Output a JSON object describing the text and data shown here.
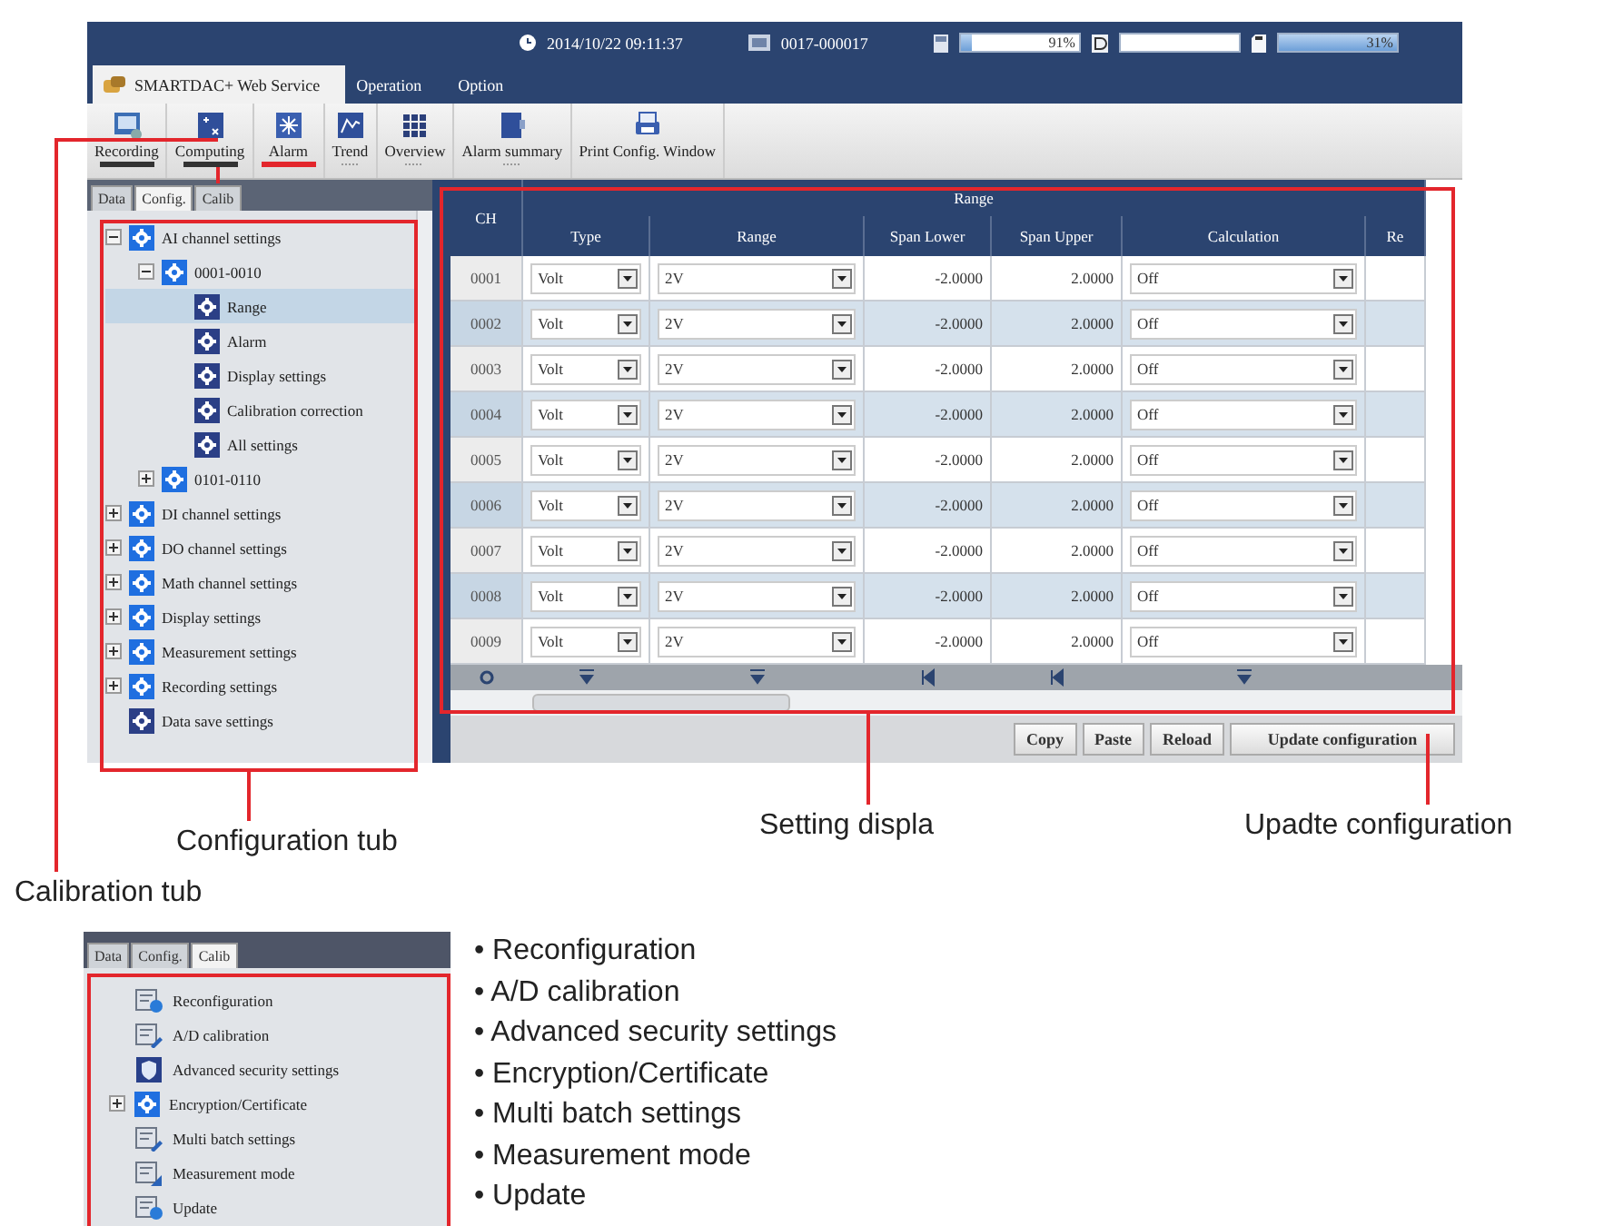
{
  "header": {
    "datetime": "2014/10/22 09:11:37",
    "device_id": "0017-000017",
    "meters": [
      {
        "kind": "memory",
        "reading": "91%",
        "level": 0.1
      },
      {
        "kind": "drive"
      },
      {
        "kind": "card",
        "reading": "31%",
        "level": 1
      }
    ]
  },
  "app_tabs": [
    {
      "label": "SMARTDAC+ Web Service",
      "selected": true
    },
    {
      "label": "Operation",
      "selected": false
    },
    {
      "label": "Option",
      "selected": false
    }
  ],
  "toolbar": [
    {
      "label": "Recording",
      "kind": "bar"
    },
    {
      "label": "Computing",
      "kind": "bar"
    },
    {
      "label": "Alarm",
      "kind": "alert"
    },
    {
      "label": "Trend",
      "kind": "dots"
    },
    {
      "label": "Overview",
      "kind": "dots"
    },
    {
      "label": "Alarm summary",
      "kind": "dots"
    },
    {
      "label": "Print Config. Window",
      "kind": "plain"
    }
  ],
  "side_tabs": [
    {
      "label": "Data",
      "selected": false
    },
    {
      "label": "Config.",
      "selected": true
    },
    {
      "label": "Calib",
      "selected": false
    }
  ],
  "tree": [
    {
      "label": "AI channel settings",
      "expanded": true,
      "selected": false,
      "children": [
        {
          "label": "0001-0010",
          "expanded": true,
          "selected": false,
          "children": [
            {
              "label": "Range",
              "selected": true
            },
            {
              "label": "Alarm",
              "selected": false
            },
            {
              "label": "Display settings",
              "selected": false
            },
            {
              "label": "Calibration correction",
              "selected": false
            },
            {
              "label": "All settings",
              "selected": false
            }
          ]
        },
        {
          "label": "0101-0110",
          "expanded": false,
          "selected": false
        }
      ]
    },
    {
      "label": "DI channel settings",
      "expanded": false,
      "selected": false
    },
    {
      "label": "DO channel settings",
      "expanded": false,
      "selected": false
    },
    {
      "label": "Math channel settings",
      "expanded": false,
      "selected": false
    },
    {
      "label": "Display settings",
      "expanded": false,
      "selected": false
    },
    {
      "label": "Measurement settings",
      "expanded": false,
      "selected": false
    },
    {
      "label": "Recording settings",
      "expanded": false,
      "selected": false
    },
    {
      "label": "Data save settings",
      "selected": false
    }
  ],
  "table": {
    "group_header": "Range",
    "columns": [
      "CH",
      "Type",
      "Range",
      "Span Lower",
      "Span Upper",
      "Calculation",
      "Re"
    ],
    "rows": [
      {
        "ch": "0001",
        "type": "Volt",
        "range": "2V",
        "span_lower": "-2.0000",
        "span_upper": "2.0000",
        "calculation": "Off"
      },
      {
        "ch": "0002",
        "type": "Volt",
        "range": "2V",
        "span_lower": "-2.0000",
        "span_upper": "2.0000",
        "calculation": "Off"
      },
      {
        "ch": "0003",
        "type": "Volt",
        "range": "2V",
        "span_lower": "-2.0000",
        "span_upper": "2.0000",
        "calculation": "Off"
      },
      {
        "ch": "0004",
        "type": "Volt",
        "range": "2V",
        "span_lower": "-2.0000",
        "span_upper": "2.0000",
        "calculation": "Off"
      },
      {
        "ch": "0005",
        "type": "Volt",
        "range": "2V",
        "span_lower": "-2.0000",
        "span_upper": "2.0000",
        "calculation": "Off"
      },
      {
        "ch": "0006",
        "type": "Volt",
        "range": "2V",
        "span_lower": "-2.0000",
        "span_upper": "2.0000",
        "calculation": "Off"
      },
      {
        "ch": "0007",
        "type": "Volt",
        "range": "2V",
        "span_lower": "-2.0000",
        "span_upper": "2.0000",
        "calculation": "Off"
      },
      {
        "ch": "0008",
        "type": "Volt",
        "range": "2V",
        "span_lower": "-2.0000",
        "span_upper": "2.0000",
        "calculation": "Off"
      },
      {
        "ch": "0009",
        "type": "Volt",
        "range": "2V",
        "span_lower": "-2.0000",
        "span_upper": "2.0000",
        "calculation": "Off"
      }
    ]
  },
  "buttons": [
    "Copy",
    "Paste",
    "Reload",
    "Update configuration"
  ],
  "callouts": [
    {
      "label": "Configuration tub"
    },
    {
      "label": "Setting displa"
    },
    {
      "label": "Upadte configuration"
    },
    {
      "label": "Calibration tub"
    }
  ],
  "calib_inset": {
    "tabs": [
      {
        "label": "Data",
        "selected": false
      },
      {
        "label": "Config.",
        "selected": false
      },
      {
        "label": "Calib",
        "selected": true
      }
    ],
    "items": [
      {
        "label": "Reconfiguration",
        "kind": "refresh"
      },
      {
        "label": "A/D calibration",
        "kind": "edit"
      },
      {
        "label": "Advanced security settings",
        "kind": "shield"
      },
      {
        "label": "Encryption/Certificate",
        "kind": "gear",
        "expanded": false
      },
      {
        "label": "Multi batch settings",
        "kind": "edit"
      },
      {
        "label": "Measurement mode",
        "kind": "chart"
      },
      {
        "label": "Update",
        "kind": "refresh"
      }
    ]
  },
  "bullets": [
    "• Reconfiguration",
    "• A/D calibration",
    "• Advanced security settings",
    "• Encryption/Certificate",
    "• Multi batch settings",
    "• Measurement mode",
    "• Update"
  ]
}
